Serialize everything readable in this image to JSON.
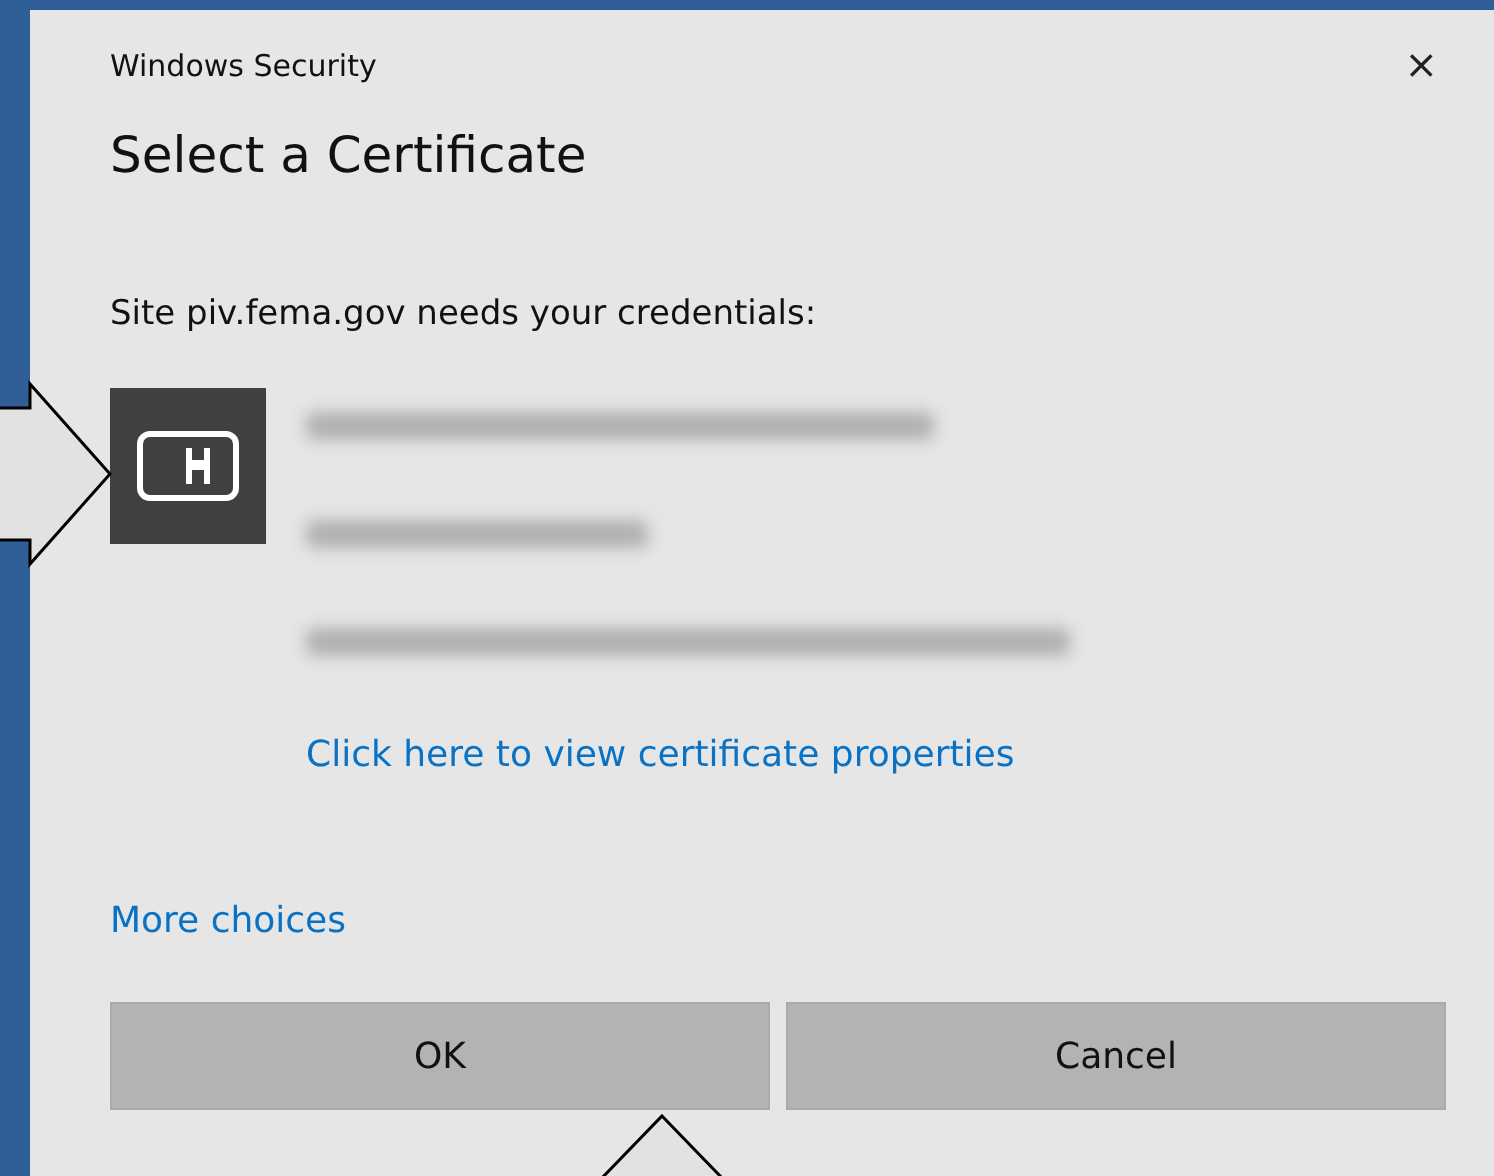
{
  "window": {
    "title": "Windows Security",
    "close": "×"
  },
  "heading": "Select a Certificate",
  "message": "Site piv.fema.gov needs your credentials:",
  "certificate": {
    "details": [
      {
        "kind": "redacted"
      },
      {
        "kind": "redacted"
      },
      {
        "kind": "redacted"
      }
    ],
    "link": "Click here to view certificate properties"
  },
  "more_choices": "More choices",
  "buttons": [
    {
      "label": "OK"
    },
    {
      "label": "Cancel"
    }
  ],
  "annotations": [
    {
      "kind": "arrow"
    },
    {
      "kind": "arrow"
    }
  ]
}
